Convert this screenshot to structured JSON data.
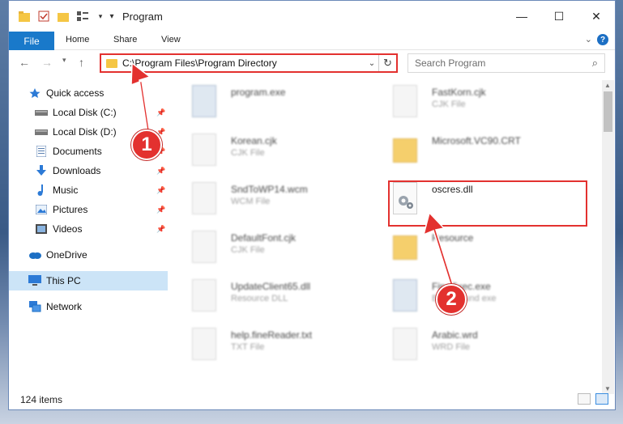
{
  "window": {
    "title": "Program",
    "controls": {
      "minimize": "—",
      "maximize": "☐",
      "close": "✕"
    }
  },
  "ribbon": {
    "file": "File",
    "tabs": [
      "Home",
      "Share",
      "View"
    ],
    "help": "?"
  },
  "address": {
    "path": "C:\\Program Files\\Program Directory"
  },
  "search": {
    "placeholder": "Search Program"
  },
  "sidebar": {
    "items": [
      {
        "label": "Quick access",
        "icon": "star-icon"
      },
      {
        "label": "Local Disk (C:)",
        "icon": "drive-icon"
      },
      {
        "label": "Local Disk (D:)",
        "icon": "drive-icon"
      },
      {
        "label": "Documents",
        "icon": "documents-icon"
      },
      {
        "label": "Downloads",
        "icon": "download-icon"
      },
      {
        "label": "Music",
        "icon": "music-icon"
      },
      {
        "label": "Pictures",
        "icon": "pictures-icon"
      },
      {
        "label": "Videos",
        "icon": "videos-icon"
      },
      {
        "label": "OneDrive",
        "icon": "cloud-icon"
      },
      {
        "label": "This PC",
        "icon": "computer-icon"
      },
      {
        "label": "Network",
        "icon": "network-icon"
      }
    ]
  },
  "files": {
    "left": [
      {
        "name": "program.exe",
        "type": ""
      },
      {
        "name": "Korean.cjk",
        "type": "CJK File"
      },
      {
        "name": "SndToWP14.wcm",
        "type": "WCM File"
      },
      {
        "name": "DefaultFont.cjk",
        "type": "CJK File"
      },
      {
        "name": "UpdateClient65.dll",
        "type": "Resource DLL"
      },
      {
        "name": "help.fineReader.txt",
        "type": "TXT File"
      }
    ],
    "right": [
      {
        "name": "FastKorn.cjk",
        "type": "CJK File"
      },
      {
        "name": "Microsoft.VC90.CRT",
        "type": ""
      },
      {
        "name": "oscres.dll",
        "type": ""
      },
      {
        "name": "Resource",
        "type": ""
      },
      {
        "name": "FineExec.exe",
        "type": "Background exe"
      },
      {
        "name": "Arabic.wrd",
        "type": "WRD File"
      }
    ]
  },
  "status": {
    "count": "124 items"
  },
  "callouts": {
    "one": "1",
    "two": "2"
  },
  "colors": {
    "accent": "#1979ca",
    "callout": "#e3312f",
    "selected": "#cce4f7"
  }
}
